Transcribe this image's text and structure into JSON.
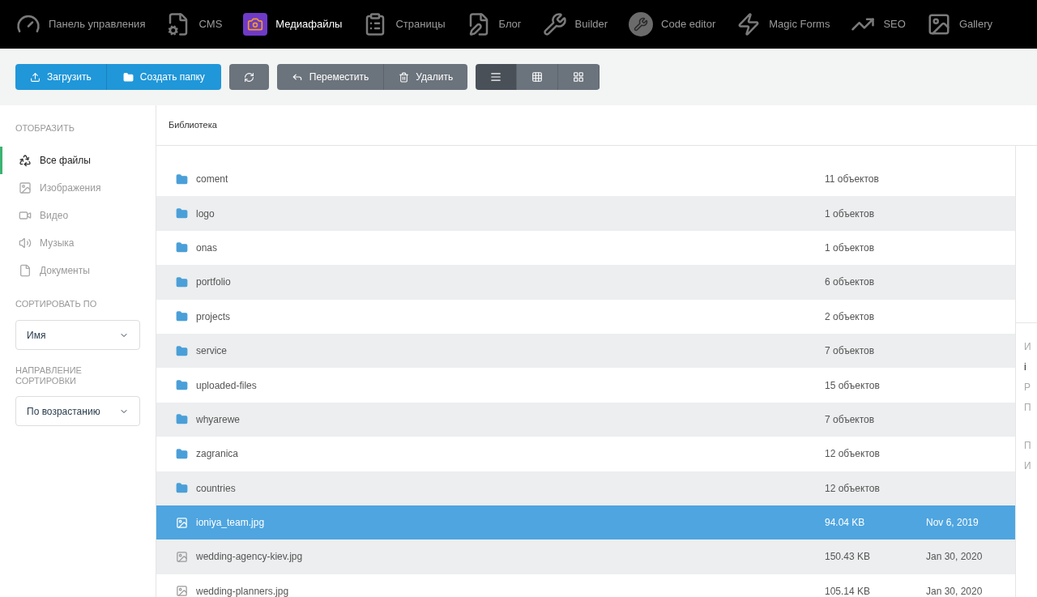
{
  "nav": [
    {
      "label": "Панель управления",
      "selected": false
    },
    {
      "label": "CMS",
      "selected": false
    },
    {
      "label": "Медиафайлы",
      "selected": true
    },
    {
      "label": "Страницы",
      "selected": false
    },
    {
      "label": "Блог",
      "selected": false
    },
    {
      "label": "Builder",
      "selected": false
    },
    {
      "label": "Code editor",
      "selected": false
    },
    {
      "label": "Magic Forms",
      "selected": false
    },
    {
      "label": "SEO",
      "selected": false
    },
    {
      "label": "Gallery",
      "selected": false
    }
  ],
  "toolbar": {
    "upload": "Загрузить",
    "create_folder": "Создать папку",
    "move": "Переместить",
    "delete": "Удалить",
    "views": [
      {
        "selected": true
      },
      {
        "selected": false
      },
      {
        "selected": false
      }
    ]
  },
  "sidebar": {
    "display_heading": "ОТОБРАЗИТЬ",
    "filters": [
      {
        "label": "Все файлы",
        "selected": true
      },
      {
        "label": "Изображения",
        "selected": false
      },
      {
        "label": "Видео",
        "selected": false
      },
      {
        "label": "Музыка",
        "selected": false
      },
      {
        "label": "Документы",
        "selected": false
      }
    ],
    "sort_heading": "СОРТИРОВАТЬ ПО",
    "sort_value": "Имя",
    "direction_heading": "НАПРАВЛЕНИЕ СОРТИРОВКИ",
    "direction_value": "По возрастанию"
  },
  "breadcrumb": "Библиотека",
  "rows": [
    {
      "kind": "folder",
      "name": "coment",
      "size": "11 объектов",
      "selected": false
    },
    {
      "kind": "folder",
      "name": "logo",
      "size": "1 объектов",
      "selected": false
    },
    {
      "kind": "folder",
      "name": "onas",
      "size": "1 объектов",
      "selected": false
    },
    {
      "kind": "folder",
      "name": "portfolio",
      "size": "6 объектов",
      "selected": false
    },
    {
      "kind": "folder",
      "name": "projects",
      "size": "2 объектов",
      "selected": false
    },
    {
      "kind": "folder",
      "name": "service",
      "size": "7 объектов",
      "selected": false
    },
    {
      "kind": "folder",
      "name": "uploaded-files",
      "size": "15 объектов",
      "selected": false
    },
    {
      "kind": "folder",
      "name": "whyarewe",
      "size": "7 объектов",
      "selected": false
    },
    {
      "kind": "folder",
      "name": "zagranica",
      "size": "12 объектов",
      "selected": false
    },
    {
      "kind": "folder",
      "name": "countries",
      "size": "12 объектов",
      "selected": false
    },
    {
      "kind": "image",
      "name": "ioniya_team.jpg",
      "size": "94.04 KB",
      "date": "Nov 6, 2019",
      "selected": true
    },
    {
      "kind": "image",
      "name": "wedding-agency-kiev.jpg",
      "size": "150.43 KB",
      "date": "Jan 30, 2020",
      "selected": false
    },
    {
      "kind": "image",
      "name": "wedding-planners.jpg",
      "size": "105.14 KB",
      "date": "Jan 30, 2020",
      "selected": false
    }
  ],
  "details": [
    {
      "kind": "label",
      "text": "И"
    },
    {
      "kind": "value",
      "text": "i"
    },
    {
      "kind": "label",
      "text": "Р"
    },
    {
      "kind": "label",
      "text": "П"
    },
    {
      "kind": "gap"
    },
    {
      "kind": "label",
      "text": "П"
    },
    {
      "kind": "label",
      "text": "И"
    }
  ]
}
